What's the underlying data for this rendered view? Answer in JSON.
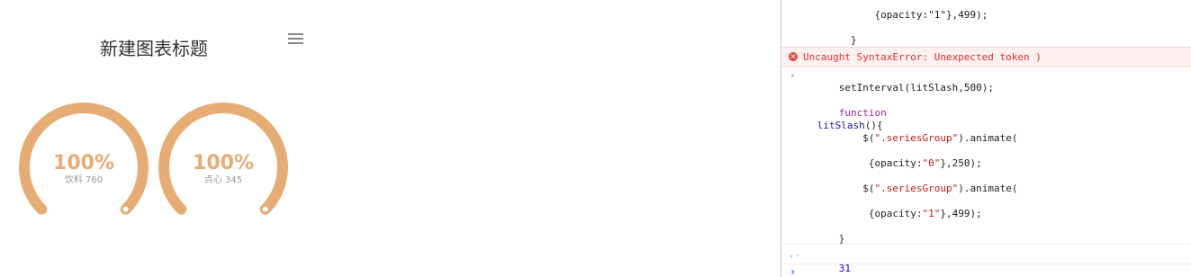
{
  "chart": {
    "title": "新建图表标题",
    "menu_icon": "hamburger-menu-icon",
    "accent_color": "#e6ac73",
    "gauges": [
      {
        "value_text": "100%",
        "label": "饮料 760",
        "percent": 100
      },
      {
        "value_text": "100%",
        "label": "点心 345",
        "percent": 100
      }
    ]
  },
  "chart_data": {
    "type": "gauge",
    "title": "新建图表标题",
    "categories": [
      "饮料",
      "点心"
    ],
    "values": [
      760,
      345
    ],
    "percent": [
      100,
      100
    ],
    "colors": [
      "#e6ac73"
    ]
  },
  "console": {
    "lines": {
      "top_snippet": "      {opacity:\"1\"},499);",
      "top_close": "  }",
      "error": "Uncaught SyntaxError: Unexpected token )",
      "cmd1": "setInterval(litSlash,500);",
      "fn_kw": "function",
      "fn_name": "litSlash",
      "fn_tail": "(){",
      "call1_pre": "    $(",
      "call1_str": "\".seriesGroup\"",
      "call1_post": ").animate(",
      "args1_pre": "     {opacity:",
      "args1_str": "\"0\"",
      "args1_post": "},250);",
      "call2_pre": "    $(",
      "call2_str": "\".seriesGroup\"",
      "call2_post": ").animate(",
      "args2_pre": "     {opacity:",
      "args2_str": "\"1\"",
      "args2_post": "},499);",
      "close": "}",
      "result": "31"
    },
    "error_icon": "error-x-icon",
    "error_color": "#e03030"
  }
}
